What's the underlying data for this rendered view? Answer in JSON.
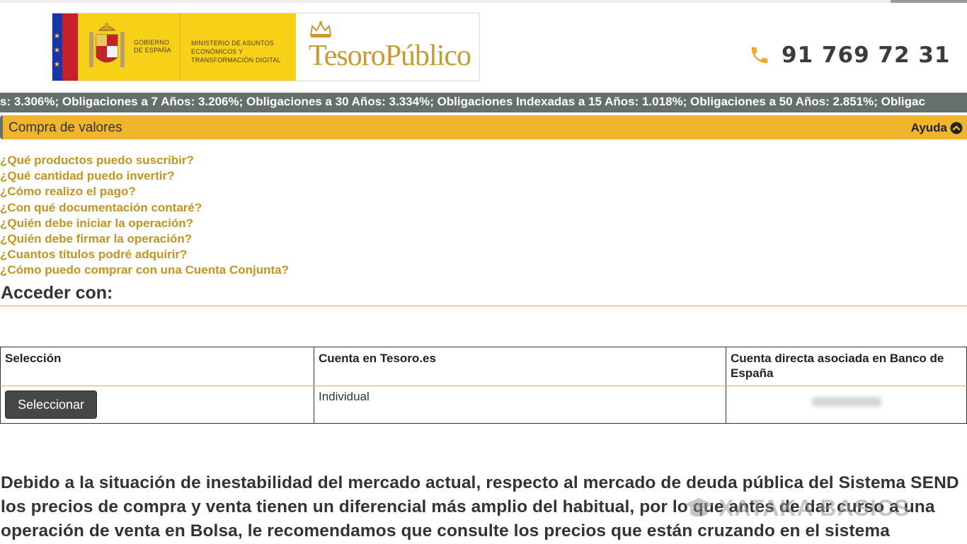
{
  "header": {
    "gobierno": "GOBIERNO DE ESPAÑA",
    "ministerio": "MINISTERIO DE ASUNTOS ECONÓMICOS Y TRANSFORMACIÓN DIGITAL",
    "brand": "TesoroPúblico",
    "phone": "91 769 72 31"
  },
  "ticker": {
    "text": "s: 3.306%; Obligaciones a 7 Años: 3.206%; Obligaciones a 30 Años: 3.334%; Obligaciones Indexadas a 15 Años: 1.018%; Obligaciones a 50 Años: 2.851%; Obligac"
  },
  "section": {
    "title": "Compra de valores",
    "help_label": "Ayuda"
  },
  "faq": [
    "¿Qué productos puedo suscribir?",
    "¿Qué cantidad puedo invertir?",
    "¿Cómo realizo el pago?",
    "¿Con qué documentación contaré?",
    "¿Quién debe iniciar la operación?",
    "¿Quién debe firmar la operación?",
    "¿Cuantos títulos podré adquirir?",
    "¿Cómo puedo comprar con una Cuenta Conjunta?"
  ],
  "access": {
    "heading": "Acceder con:"
  },
  "table": {
    "headers": [
      "Selección",
      "Cuenta en Tesoro.es",
      "Cuenta directa asociada en Banco de España"
    ],
    "row": {
      "button_label": "Seleccionar",
      "account_type": "Individual"
    }
  },
  "notice": {
    "text": "Debido a la situación de inestabilidad del mercado actual, respecto al mercado de deuda pública del Sistema SEND los precios de compra y venta tienen un diferencial más amplio del habitual, por lo que antes de dar curso a una operación de venta en Bolsa, le recomendamos que consulte los precios que están cruzando en el sistema"
  },
  "watermark": {
    "text": "XATAKA BASICS"
  },
  "colors": {
    "accent": "#f0b52c",
    "link": "#c4941f",
    "ticker_bg": "#65706d",
    "brand_gold": "#c99a30"
  }
}
